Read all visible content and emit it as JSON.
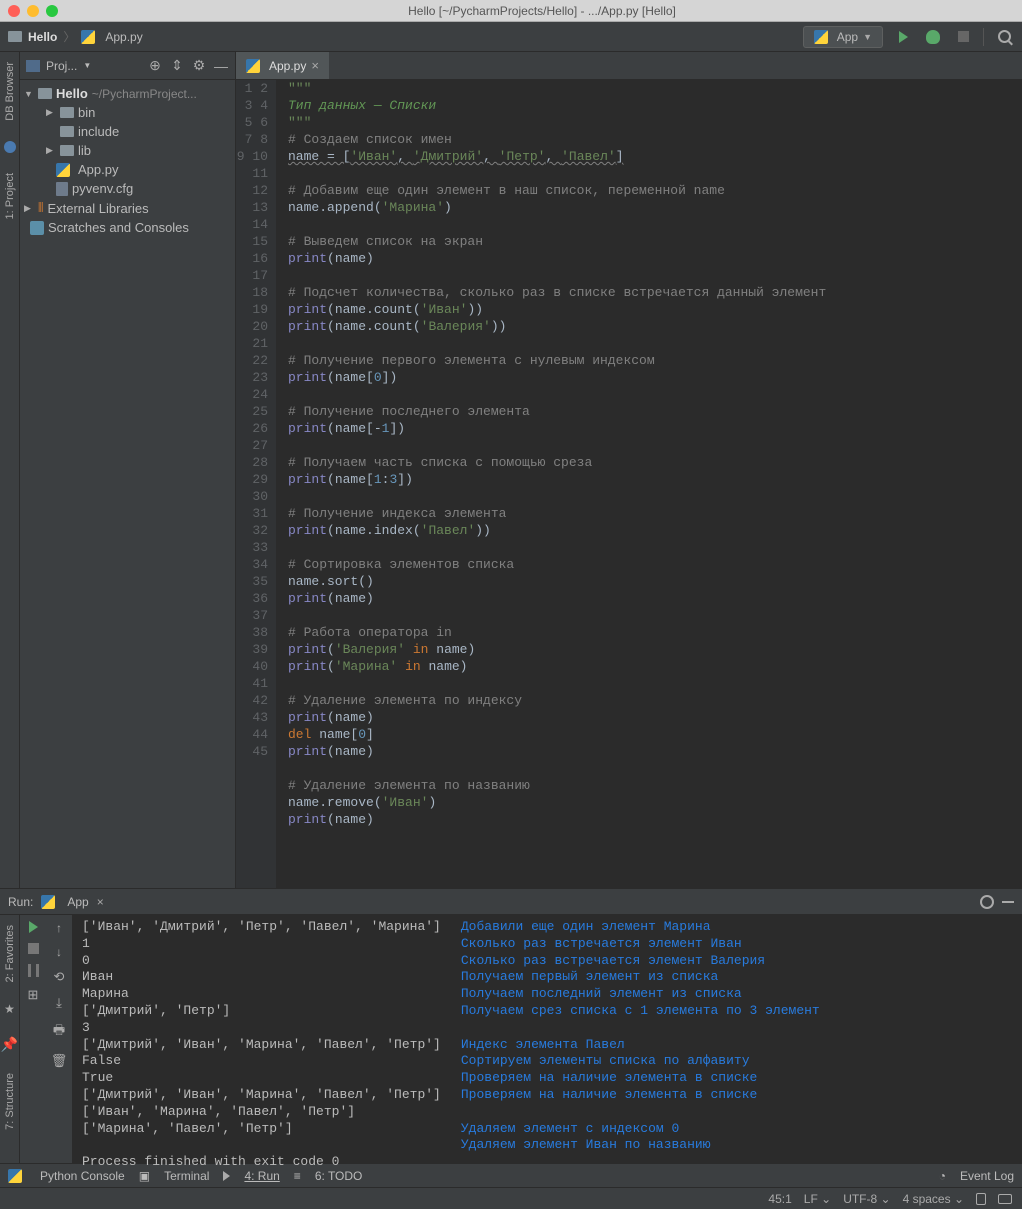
{
  "window": {
    "title": "Hello [~/PycharmProjects/Hello] - .../App.py [Hello]"
  },
  "breadcrumb": {
    "project": "Hello",
    "file": "App.py"
  },
  "runconfig": {
    "name": "App"
  },
  "sidebar": {
    "title": "Proj...",
    "root": "Hello",
    "rootPath": "~/PycharmProject...",
    "items": [
      "bin",
      "include",
      "lib",
      "App.py",
      "pyvenv.cfg"
    ],
    "external": "External Libraries",
    "scratches": "Scratches and Consoles"
  },
  "rails": {
    "db": "DB Browser",
    "project": "1: Project",
    "favorites": "2: Favorites",
    "structure": "7: Structure"
  },
  "tab": {
    "name": "App.py"
  },
  "lines": 45,
  "code": {
    "l1": "\"\"\"",
    "l2": "Тип данных — Списки",
    "l3": "\"\"\"",
    "l4": "# Создаем список имен",
    "l5a": "name = [",
    "l5b": "'Иван'",
    "l5c": ", ",
    "l5d": "'Дмитрий'",
    "l5e": ", ",
    "l5f": "'Петр'",
    "l5g": ", ",
    "l5h": "'Павел'",
    "l5i": "]",
    "l7": "# Добавим еще один элемент в наш список, переменной name",
    "l8a": "name.append(",
    "l8b": "'Марина'",
    "l8c": ")",
    "l10": "# Выведем список на экран",
    "l11a": "print",
    "l11b": "(name)",
    "l13": "# Подсчет количества, сколько раз в списке встречается данный элемент",
    "l14a": "print",
    "l14b": "(name.count(",
    "l14c": "'Иван'",
    "l14d": "))",
    "l15a": "print",
    "l15b": "(name.count(",
    "l15c": "'Валерия'",
    "l15d": "))",
    "l17": "# Получение первого элемента с нулевым индексом",
    "l18a": "print",
    "l18b": "(name[",
    "l18c": "0",
    "l18d": "])",
    "l20": "# Получение последнего элемента",
    "l21a": "print",
    "l21b": "(name[-",
    "l21c": "1",
    "l21d": "])",
    "l23": "# Получаем часть списка с помощью среза",
    "l24a": "print",
    "l24b": "(name[",
    "l24c": "1",
    "l24d": ":",
    "l24e": "3",
    "l24f": "])",
    "l26": "# Получение индекса элемента",
    "l27a": "print",
    "l27b": "(name.index(",
    "l27c": "'Павел'",
    "l27d": "))",
    "l29": "# Сортировка элементов списка",
    "l30": "name.sort()",
    "l31a": "print",
    "l31b": "(name)",
    "l33": "# Работа оператора in",
    "l34a": "print",
    "l34b": "(",
    "l34c": "'Валерия'",
    "l34d": " ",
    "l34e": "in",
    "l34f": " name)",
    "l35a": "print",
    "l35b": "(",
    "l35c": "'Марина'",
    "l35d": " ",
    "l35e": "in",
    "l35f": " name)",
    "l37": "# Удаление элемента по индексу",
    "l38a": "print",
    "l38b": "(name)",
    "l39a": "del ",
    "l39b": "name[",
    "l39c": "0",
    "l39d": "]",
    "l40a": "print",
    "l40b": "(name)",
    "l42": "# Удаление элемента по названию",
    "l43a": "name.remove(",
    "l43b": "'Иван'",
    "l43c": ")",
    "l44a": "print",
    "l44b": "(name)"
  },
  "run": {
    "label": "Run:",
    "tab": "App",
    "output": [
      "['Иван', 'Дмитрий', 'Петр', 'Павел', 'Марина']",
      "1",
      "0",
      "Иван",
      "Марина",
      "['Дмитрий', 'Петр']",
      "3",
      "['Дмитрий', 'Иван', 'Марина', 'Павел', 'Петр']",
      "False",
      "True",
      "['Дмитрий', 'Иван', 'Марина', 'Павел', 'Петр']",
      "['Иван', 'Марина', 'Павел', 'Петр']",
      "['Марина', 'Павел', 'Петр']",
      "",
      "Process finished with exit code 0"
    ],
    "annotations": [
      "Добавили еще один элемент Марина",
      "Сколько раз встречается элемент Иван",
      "Сколько раз встречается элемент Валерия",
      "Получаем первый элемент из списка",
      "Получаем последний элемент из списка",
      "Получаем срез списка с 1 элемента по 3 элемент",
      "",
      "Индекс элемента Павел",
      "Сортируем элементы списка по алфавиту",
      "Проверяем на наличие элемента в списке",
      "Проверяем на наличие элемента в списке",
      "",
      "Удаляем элемент с индексом 0",
      "Удаляем элемент Иван по названию"
    ]
  },
  "bottom": {
    "pyconsole": "Python Console",
    "terminal": "Terminal",
    "run": "4: Run",
    "todo": "6: TODO",
    "eventlog": "Event Log"
  },
  "status": {
    "pos": "45:1",
    "sep": "LF",
    "enc": "UTF-8",
    "indent": "4 spaces"
  }
}
